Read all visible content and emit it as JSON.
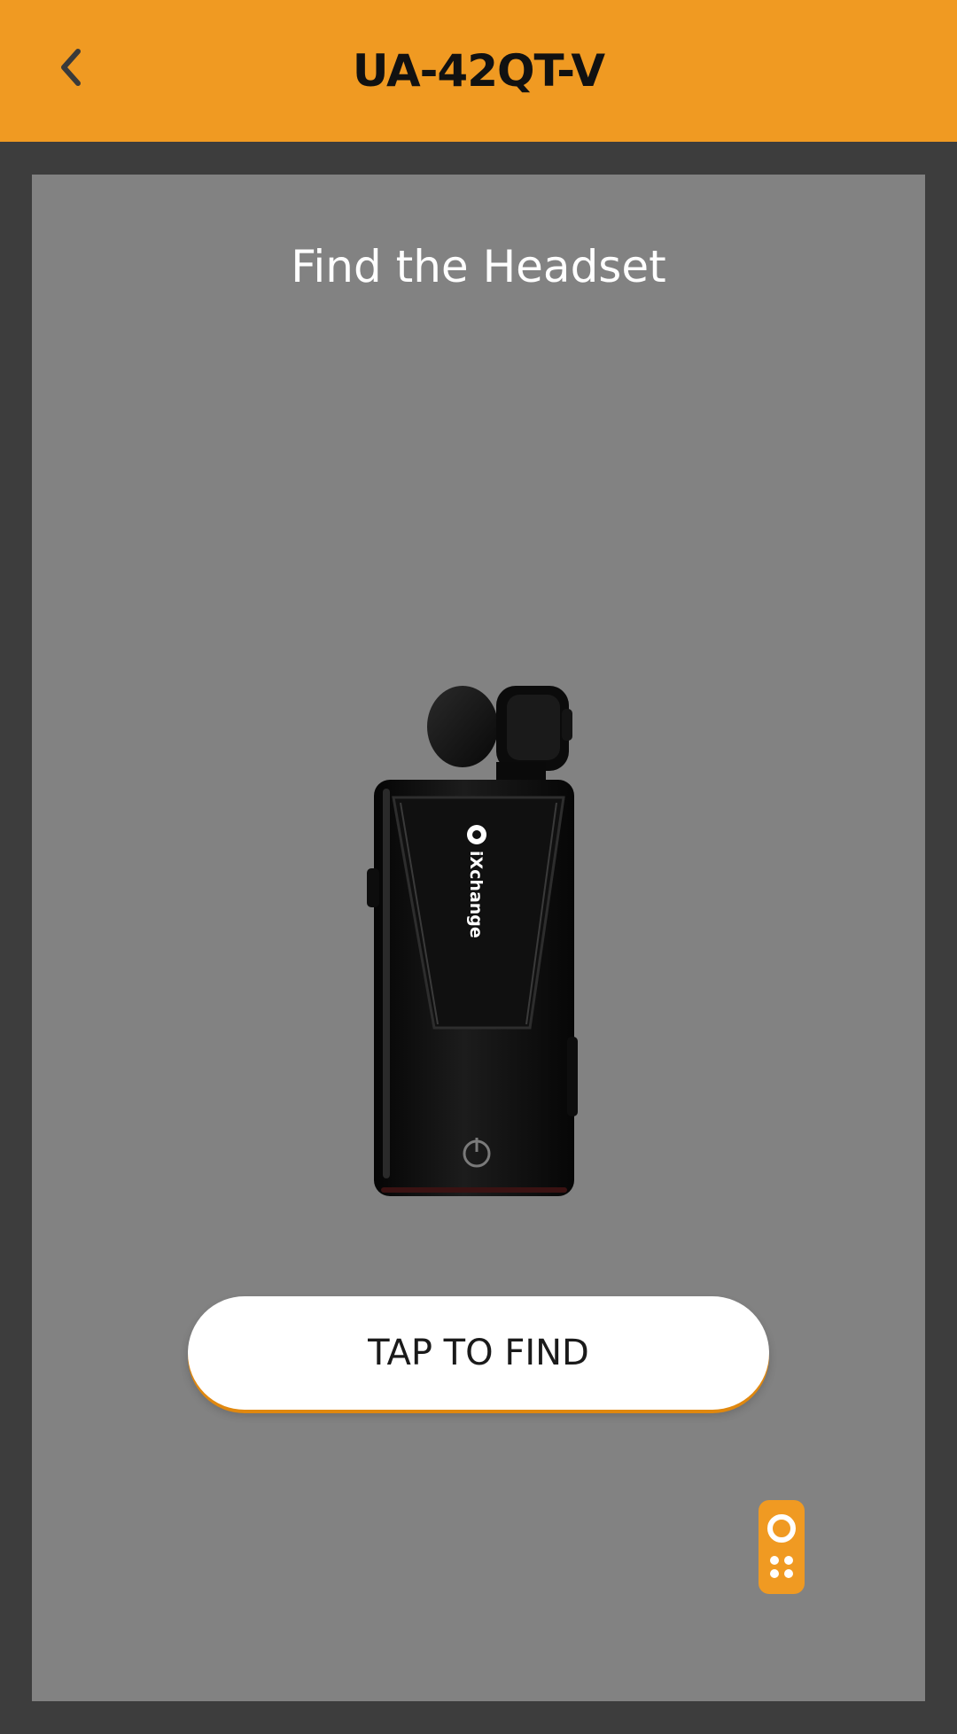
{
  "header": {
    "title": "UA-42QT-V",
    "back_icon": "chevron-left-icon",
    "accent_color": "#f09a22"
  },
  "main": {
    "heading": "Find the Headset",
    "product_image": {
      "brand_label": "iXchange",
      "icon": "headset-device-image"
    },
    "find_button_label": "TAP TO FIND",
    "panel_color": "#828282"
  },
  "floating": {
    "remote_icon": "remote-control-icon"
  }
}
